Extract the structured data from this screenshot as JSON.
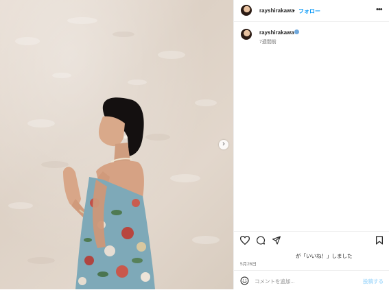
{
  "post": {
    "image_alt": "Woman in floral strapless dress posing against a textured wall",
    "next_icon": "chevron-right-icon",
    "next_glyph": "›"
  },
  "header": {
    "username": "rayshirakawa",
    "separator": "•",
    "follow_label": "フォロー",
    "more_icon": "more-horizontal-icon",
    "more_glyph": "•••"
  },
  "caption": {
    "username": "rayshirakawa",
    "time_ago": "7週間前"
  },
  "actions": {
    "like_icon": "heart-icon",
    "comment_icon": "comment-icon",
    "share_icon": "paper-plane-icon",
    "save_icon": "bookmark-icon"
  },
  "likes_text": "が「いいね！」しました",
  "post_date": "5月26日",
  "comment": {
    "emoji_icon": "smiley-icon",
    "placeholder": "コメントを追加...",
    "post_label": "投稿する"
  },
  "colors": {
    "accent": "#0095f6",
    "post_disabled": "#b2dffc",
    "text": "#262626",
    "muted": "#737373",
    "border": "#efefef"
  }
}
